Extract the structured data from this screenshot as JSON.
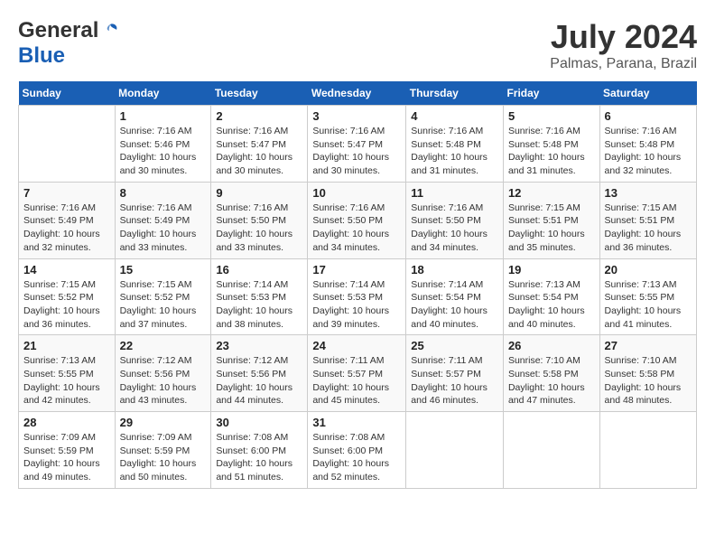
{
  "header": {
    "logo_general": "General",
    "logo_blue": "Blue",
    "month_year": "July 2024",
    "location": "Palmas, Parana, Brazil"
  },
  "calendar": {
    "days_of_week": [
      "Sunday",
      "Monday",
      "Tuesday",
      "Wednesday",
      "Thursday",
      "Friday",
      "Saturday"
    ],
    "weeks": [
      [
        {
          "day": "",
          "info": ""
        },
        {
          "day": "1",
          "info": "Sunrise: 7:16 AM\nSunset: 5:46 PM\nDaylight: 10 hours\nand 30 minutes."
        },
        {
          "day": "2",
          "info": "Sunrise: 7:16 AM\nSunset: 5:47 PM\nDaylight: 10 hours\nand 30 minutes."
        },
        {
          "day": "3",
          "info": "Sunrise: 7:16 AM\nSunset: 5:47 PM\nDaylight: 10 hours\nand 30 minutes."
        },
        {
          "day": "4",
          "info": "Sunrise: 7:16 AM\nSunset: 5:48 PM\nDaylight: 10 hours\nand 31 minutes."
        },
        {
          "day": "5",
          "info": "Sunrise: 7:16 AM\nSunset: 5:48 PM\nDaylight: 10 hours\nand 31 minutes."
        },
        {
          "day": "6",
          "info": "Sunrise: 7:16 AM\nSunset: 5:48 PM\nDaylight: 10 hours\nand 32 minutes."
        }
      ],
      [
        {
          "day": "7",
          "info": "Sunrise: 7:16 AM\nSunset: 5:49 PM\nDaylight: 10 hours\nand 32 minutes."
        },
        {
          "day": "8",
          "info": "Sunrise: 7:16 AM\nSunset: 5:49 PM\nDaylight: 10 hours\nand 33 minutes."
        },
        {
          "day": "9",
          "info": "Sunrise: 7:16 AM\nSunset: 5:50 PM\nDaylight: 10 hours\nand 33 minutes."
        },
        {
          "day": "10",
          "info": "Sunrise: 7:16 AM\nSunset: 5:50 PM\nDaylight: 10 hours\nand 34 minutes."
        },
        {
          "day": "11",
          "info": "Sunrise: 7:16 AM\nSunset: 5:50 PM\nDaylight: 10 hours\nand 34 minutes."
        },
        {
          "day": "12",
          "info": "Sunrise: 7:15 AM\nSunset: 5:51 PM\nDaylight: 10 hours\nand 35 minutes."
        },
        {
          "day": "13",
          "info": "Sunrise: 7:15 AM\nSunset: 5:51 PM\nDaylight: 10 hours\nand 36 minutes."
        }
      ],
      [
        {
          "day": "14",
          "info": "Sunrise: 7:15 AM\nSunset: 5:52 PM\nDaylight: 10 hours\nand 36 minutes."
        },
        {
          "day": "15",
          "info": "Sunrise: 7:15 AM\nSunset: 5:52 PM\nDaylight: 10 hours\nand 37 minutes."
        },
        {
          "day": "16",
          "info": "Sunrise: 7:14 AM\nSunset: 5:53 PM\nDaylight: 10 hours\nand 38 minutes."
        },
        {
          "day": "17",
          "info": "Sunrise: 7:14 AM\nSunset: 5:53 PM\nDaylight: 10 hours\nand 39 minutes."
        },
        {
          "day": "18",
          "info": "Sunrise: 7:14 AM\nSunset: 5:54 PM\nDaylight: 10 hours\nand 40 minutes."
        },
        {
          "day": "19",
          "info": "Sunrise: 7:13 AM\nSunset: 5:54 PM\nDaylight: 10 hours\nand 40 minutes."
        },
        {
          "day": "20",
          "info": "Sunrise: 7:13 AM\nSunset: 5:55 PM\nDaylight: 10 hours\nand 41 minutes."
        }
      ],
      [
        {
          "day": "21",
          "info": "Sunrise: 7:13 AM\nSunset: 5:55 PM\nDaylight: 10 hours\nand 42 minutes."
        },
        {
          "day": "22",
          "info": "Sunrise: 7:12 AM\nSunset: 5:56 PM\nDaylight: 10 hours\nand 43 minutes."
        },
        {
          "day": "23",
          "info": "Sunrise: 7:12 AM\nSunset: 5:56 PM\nDaylight: 10 hours\nand 44 minutes."
        },
        {
          "day": "24",
          "info": "Sunrise: 7:11 AM\nSunset: 5:57 PM\nDaylight: 10 hours\nand 45 minutes."
        },
        {
          "day": "25",
          "info": "Sunrise: 7:11 AM\nSunset: 5:57 PM\nDaylight: 10 hours\nand 46 minutes."
        },
        {
          "day": "26",
          "info": "Sunrise: 7:10 AM\nSunset: 5:58 PM\nDaylight: 10 hours\nand 47 minutes."
        },
        {
          "day": "27",
          "info": "Sunrise: 7:10 AM\nSunset: 5:58 PM\nDaylight: 10 hours\nand 48 minutes."
        }
      ],
      [
        {
          "day": "28",
          "info": "Sunrise: 7:09 AM\nSunset: 5:59 PM\nDaylight: 10 hours\nand 49 minutes."
        },
        {
          "day": "29",
          "info": "Sunrise: 7:09 AM\nSunset: 5:59 PM\nDaylight: 10 hours\nand 50 minutes."
        },
        {
          "day": "30",
          "info": "Sunrise: 7:08 AM\nSunset: 6:00 PM\nDaylight: 10 hours\nand 51 minutes."
        },
        {
          "day": "31",
          "info": "Sunrise: 7:08 AM\nSunset: 6:00 PM\nDaylight: 10 hours\nand 52 minutes."
        },
        {
          "day": "",
          "info": ""
        },
        {
          "day": "",
          "info": ""
        },
        {
          "day": "",
          "info": ""
        }
      ]
    ]
  }
}
